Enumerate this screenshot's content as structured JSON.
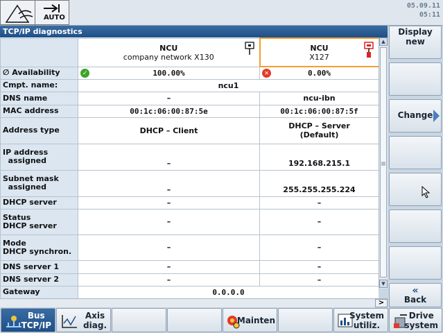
{
  "topbar": {
    "mode": "AUTO",
    "date": "05.09.11",
    "time": "05:11"
  },
  "window": {
    "title": "TCP/IP diagnostics"
  },
  "columns": [
    {
      "line1": "NCU",
      "line2": "company network X130",
      "icon": "network-plug-icon",
      "selected": false
    },
    {
      "line1": "NCU",
      "line2": "X127",
      "icon": "network-plug-red-icon",
      "selected": true
    }
  ],
  "rows": [
    {
      "label": "∅ Availability",
      "left": "100.00%",
      "right": "0.00%"
    },
    {
      "label": "Cmpt. name:",
      "merged": "ncu1"
    },
    {
      "label": "DNS name",
      "left": "–",
      "right": "ncu-ibn"
    },
    {
      "label": "MAC address",
      "left": "00:1c:06:00:87:5e",
      "right": "00:1c:06:00:87:5f"
    },
    {
      "label": "Address type",
      "left": "DHCP – Client",
      "right": "DHCP – Server\n(Default)"
    },
    {
      "label": "IP address\n  assigned",
      "left": "–",
      "right": "192.168.215.1"
    },
    {
      "label": "Subnet mask\n  assigned",
      "left": "–",
      "right": "255.255.255.224"
    },
    {
      "label": "DHCP server",
      "left": "–",
      "right": "–"
    },
    {
      "label": "Status\nDHCP server",
      "left": "–",
      "right": "–"
    },
    {
      "label": "Mode\nDHCP synchron.",
      "left": "–",
      "right": "–"
    },
    {
      "label": "DNS server 1",
      "left": "–",
      "right": "–"
    },
    {
      "label": "DNS server 2",
      "left": "–",
      "right": "–"
    },
    {
      "label": "Gateway",
      "merged": "0.0.0.0"
    }
  ],
  "vsoftkeys": {
    "k1": "Display\nnew",
    "k2": "",
    "k3": "Change",
    "k4": "",
    "k5": "",
    "k6": "",
    "k7": "",
    "k8": "Back"
  },
  "hsoftkeys": {
    "k1": "Bus\nTCP/IP",
    "k2": "Axis\ndiag.",
    "k3": "",
    "k4": "",
    "k5": "Mainten",
    "k6": "",
    "k7": "System\nutiliz.",
    "k8": "Drive\nsystem"
  },
  "colors": {
    "title_bar": "#1f4f86",
    "selection": "#f0a030",
    "ok": "#3ea329",
    "error": "#e23a2a"
  }
}
